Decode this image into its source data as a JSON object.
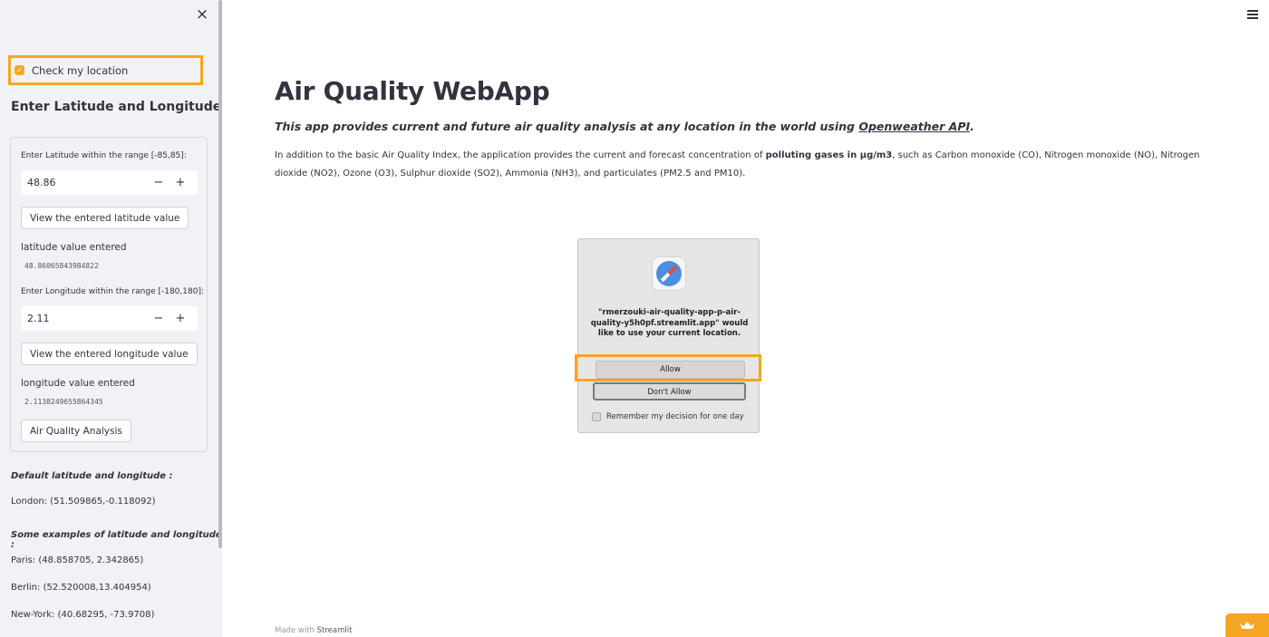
{
  "sidebar": {
    "close_icon": "×",
    "checkbox_label": "Check my location",
    "checkbox_checked": true,
    "heading": "Enter Latitude and Longitude",
    "latitude": {
      "label": "Enter Latitude within the range [-85,85]:",
      "value": "48.86",
      "minus": "−",
      "plus": "+",
      "view_button": "View the entered latitude value",
      "entered_label": "latitude value entered",
      "entered_value": "48.86065843984822"
    },
    "longitude": {
      "label": "Enter Longitude within the range [-180,180]:",
      "value": "2.11",
      "minus": "−",
      "plus": "+",
      "view_button": "View the entered longitude value",
      "entered_label": "longitude value entered",
      "entered_value": "2.1138249655864345"
    },
    "analysis_button": "Air Quality Analysis",
    "default_heading": "Default latitude and longitude :",
    "default_value": "London: (51.509865,-0.118092)",
    "examples_heading": "Some examples of latitude and longitude :",
    "examples": [
      "Paris: (48.858705, 2.342865)",
      "Berlin: (52.520008,13.404954)",
      "New-York: (40.68295, -73.9708)"
    ]
  },
  "main": {
    "menu_icon": "hamburger-menu-icon",
    "title": "Air Quality WebApp",
    "subtitle_prefix": "This app provides current and future air quality analysis at any location in the world using ",
    "subtitle_link": "Openweather API",
    "subtitle_suffix": ".",
    "para_prefix": "In addition to the basic Air Quality Index, the application provides the current and forecast concentration of ",
    "para_bold": "polluting gases in µg/m3",
    "para_suffix": ", such as Carbon monoxide (CO), Nitrogen monoxide (NO), Nitrogen dioxide (NO2), Ozone (O3), Sulphur dioxide (SO2), Ammonia (NH3), and particulates (PM2.5 and PM10).",
    "footer_prefix": "Made with ",
    "footer_brand": "Streamlit"
  },
  "dialog": {
    "icon": "safari-compass-icon",
    "message": "\"rmerzouki-air-quality-app-p-air-quality-y5h0pf.streamlit.app\" would like to use your current location.",
    "allow": "Allow",
    "deny": "Don't Allow",
    "remember": "Remember my decision for one day"
  },
  "colors": {
    "highlight": "#f5a623",
    "sidebar_bg": "#f0f2f6",
    "text": "#31333f"
  }
}
